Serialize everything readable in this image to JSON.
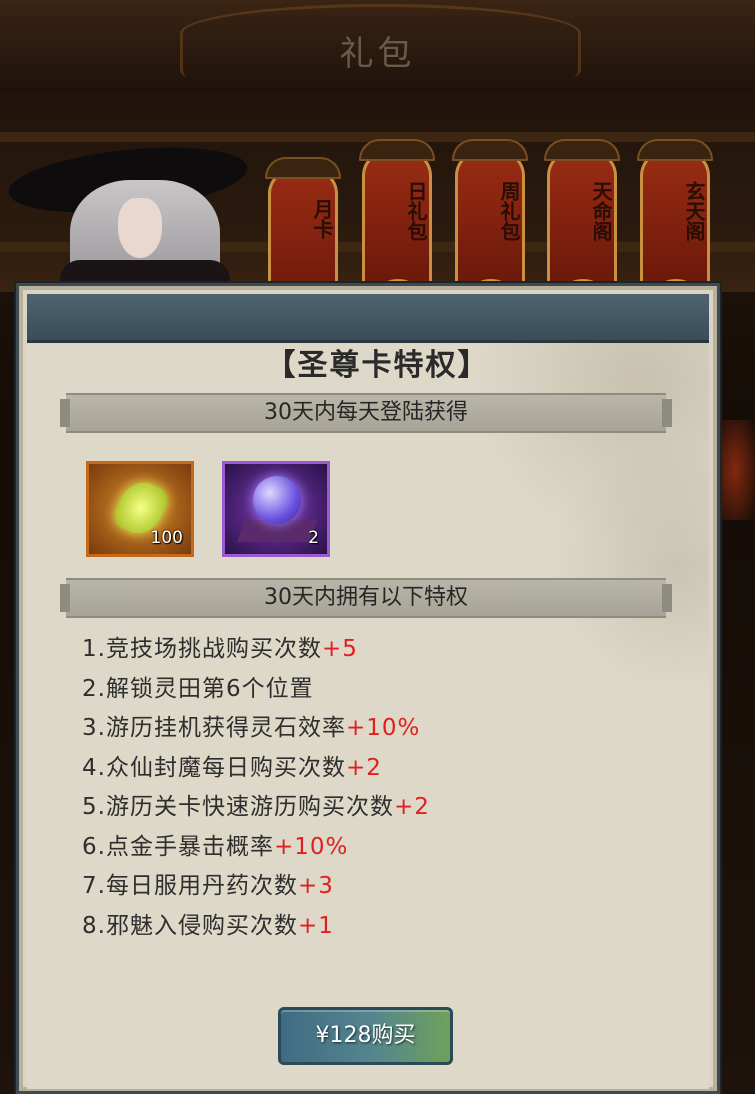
{
  "title": "礼包",
  "tabs": [
    {
      "label": "月卡"
    },
    {
      "label": "日礼包"
    },
    {
      "label": "周礼包"
    },
    {
      "label": "天命阁"
    },
    {
      "label": "玄天阁"
    }
  ],
  "card": {
    "title": "【圣尊卡特权】",
    "daily_section": "30天内每天登陆获得",
    "items": [
      {
        "icon": "jade-icon",
        "count": "100"
      },
      {
        "icon": "orb-icon",
        "count": "2"
      }
    ],
    "privilege_section": "30天内拥有以下特权",
    "privileges": [
      {
        "text": "1.竞技场挑战购买次数",
        "bonus": "+5"
      },
      {
        "text": "2.解锁灵田第6个位置",
        "bonus": ""
      },
      {
        "text": "3.游历挂机获得灵石效率",
        "bonus": "+10%"
      },
      {
        "text": "4.众仙封魔每日购买次数",
        "bonus": "+2"
      },
      {
        "text": "5.游历关卡快速游历购买次数",
        "bonus": "+2"
      },
      {
        "text": "6.点金手暴击概率",
        "bonus": "+10%"
      },
      {
        "text": "7.每日服用丹药次数",
        "bonus": "+3"
      },
      {
        "text": "8.邪魅入侵购买次数",
        "bonus": "+1"
      }
    ],
    "buy_label": "¥128购买"
  },
  "colors": {
    "bonus": "#e02020",
    "panel": "#d9d4c4",
    "header": "#3a4d59"
  }
}
